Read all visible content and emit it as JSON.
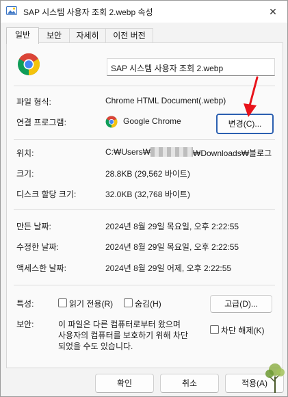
{
  "window": {
    "title": "SAP 시스템 사용자 조회 2.webp 속성",
    "close_glyph": "✕"
  },
  "tabs": [
    {
      "label": "일반",
      "active": true
    },
    {
      "label": "보안",
      "active": false
    },
    {
      "label": "자세히",
      "active": false
    },
    {
      "label": "이전 버전",
      "active": false
    }
  ],
  "general": {
    "filename": "SAP 시스템 사용자 조회 2.webp",
    "file_type_label": "파일 형식:",
    "file_type_value": "Chrome HTML Document(.webp)",
    "opens_with_label": "연결 프로그램:",
    "opens_with_app": "Google Chrome",
    "change_button": "변경(C)...",
    "location_label": "위치:",
    "location_value": "C:₩Users₩",
    "location_value_end": "₩Downloads₩블로그",
    "size_label": "크기:",
    "size_value": "28.8KB (29,562 바이트)",
    "disk_size_label": "디스크 할당 크기:",
    "disk_size_value": "32.0KB (32,768 바이트)",
    "created_label": "만든 날짜:",
    "created_value": "2024년 8월 29일 목요일, 오후 2:22:55",
    "modified_label": "수정한 날짜:",
    "modified_value": "2024년 8월 29일 목요일, 오후 2:22:55",
    "accessed_label": "액세스한 날짜:",
    "accessed_value": "2024년 8월 29일 어제, 오후 2:22:55",
    "attributes_label": "특성:",
    "readonly_label": "읽기 전용(R)",
    "hidden_label": "숨김(H)",
    "advanced_button": "고급(D)...",
    "security_label": "보안:",
    "security_text_1": "이 파일은 다른 컴퓨터로부터 왔으며",
    "security_text_2": "사용자의 컴퓨터를 보호하기 위해 차단",
    "security_text_3": "되었을 수도 있습니다.",
    "unblock_label": "차단 해제(K)"
  },
  "footer": {
    "ok": "확인",
    "cancel": "취소",
    "apply": "적용(A)"
  },
  "colors": {
    "chrome_red": "#db4437",
    "chrome_yellow": "#f4c20d",
    "chrome_green": "#0f9d58",
    "chrome_blue": "#4285f4",
    "arrow_red": "#e8131b",
    "accent_border": "#2b5fb0"
  }
}
